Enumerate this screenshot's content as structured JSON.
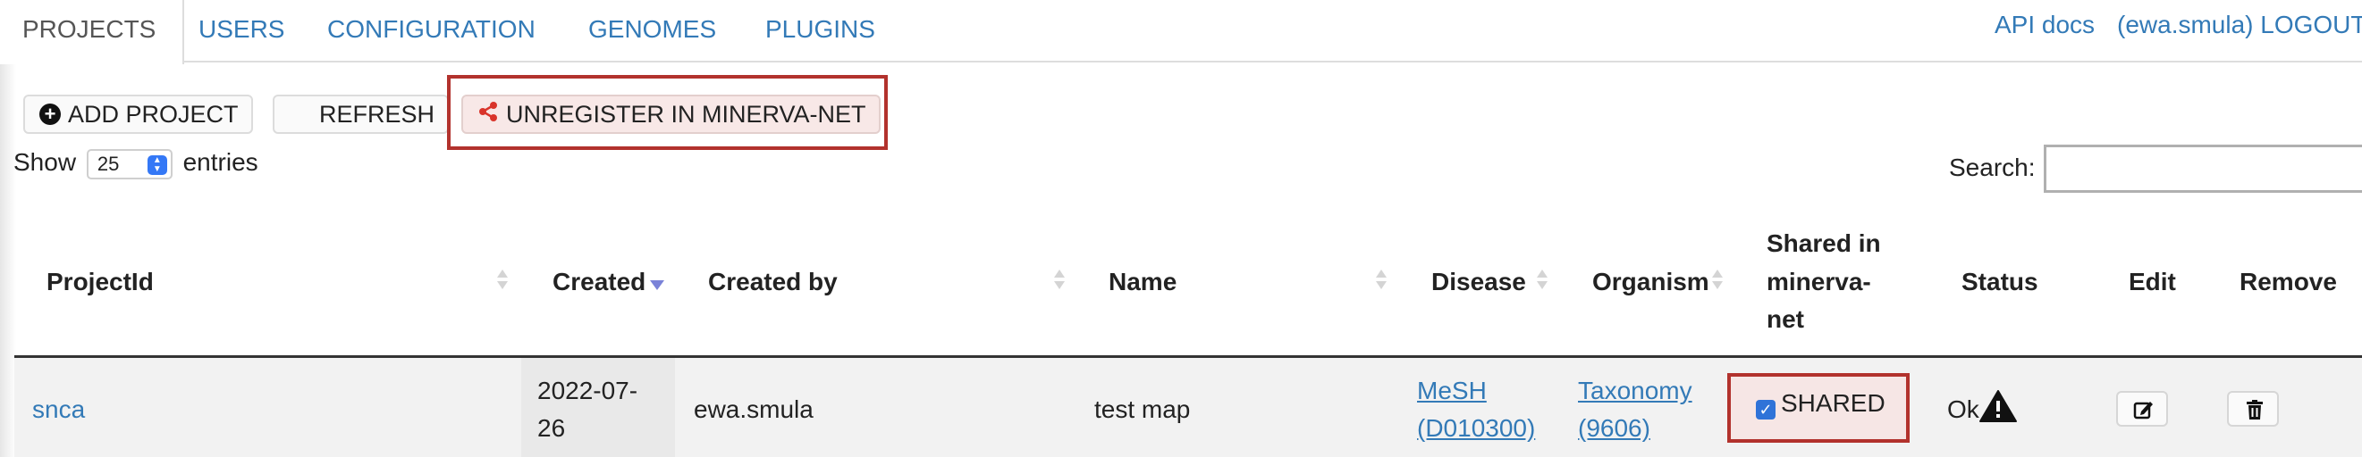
{
  "nav": {
    "tabs": [
      {
        "label": "PROJECTS",
        "active": true
      },
      {
        "label": "USERS"
      },
      {
        "label": "CONFIGURATION"
      },
      {
        "label": "GENOMES"
      },
      {
        "label": "PLUGINS"
      }
    ],
    "api_docs": "API docs",
    "logout": "(ewa.smula) LOGOUT"
  },
  "toolbar": {
    "add_project": "ADD PROJECT",
    "refresh": "REFRESH",
    "unregister": "UNREGISTER IN MINERVA-NET"
  },
  "length": {
    "show_label": "Show",
    "value": "25",
    "entries_label": "entries"
  },
  "search": {
    "label": "Search:",
    "value": ""
  },
  "table": {
    "columns": {
      "project_id": "ProjectId",
      "created": "Created",
      "created_by": "Created by",
      "name": "Name",
      "disease": "Disease",
      "organism": "Organism",
      "shared_line1": "Shared in",
      "shared_line2": "minerva-",
      "shared_line3": "net",
      "status": "Status",
      "edit": "Edit",
      "remove": "Remove"
    },
    "rows": [
      {
        "project_id": "snca",
        "created_line1": "2022-07-",
        "created_line2": "26",
        "created_by": "ewa.smula",
        "name": "test map",
        "disease_line1": "MeSH",
        "disease_line2": "(D010300)",
        "organism_line1": "Taxonomy",
        "organism_line2": "(9606)",
        "shared_checked": true,
        "shared_label": "SHARED",
        "status": "Ok"
      }
    ]
  },
  "colors": {
    "link": "#337ab7",
    "highlight_border": "#b2322d",
    "checkbox": "#2f73d8",
    "sort_active": "#7a82d8"
  },
  "icons": [
    "plus-circle-icon",
    "share-icon",
    "warning-icon",
    "edit-icon",
    "trash-icon",
    "sort-icon",
    "sort-desc-icon"
  ]
}
